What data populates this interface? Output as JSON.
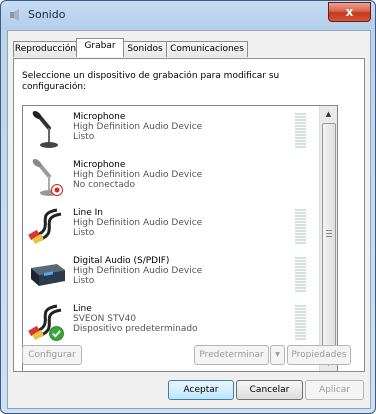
{
  "window": {
    "title": "Sonido",
    "close_label": "x"
  },
  "tabs": [
    {
      "label": "Reproducción"
    },
    {
      "label": "Grabar"
    },
    {
      "label": "Sonidos"
    },
    {
      "label": "Comunicaciones"
    }
  ],
  "active_tab": "Grabar",
  "instructions": "Seleccione un dispositivo de grabación para modificar su configuración:",
  "devices": [
    {
      "name": "Microphone",
      "description": "High Definition Audio Device",
      "status": "Listo",
      "icon": "microphone-icon",
      "badge": ""
    },
    {
      "name": "Microphone",
      "description": "High Definition Audio Device",
      "status": "No conectado",
      "icon": "microphone-icon",
      "badge": "disconnected-badge"
    },
    {
      "name": "Line In",
      "description": "High Definition Audio Device",
      "status": "Listo",
      "icon": "rca-cable-icon",
      "badge": ""
    },
    {
      "name": "Digital Audio (S/PDIF)",
      "description": "High Definition Audio Device",
      "status": "Listo",
      "icon": "digital-audio-device-icon",
      "badge": ""
    },
    {
      "name": "Line",
      "description": "SVEON STV40",
      "status": "Dispositivo predeterminado",
      "icon": "rca-cable-icon",
      "badge": "default-check-badge"
    }
  ],
  "buttons": {
    "configure": "Configurar",
    "set_default": "Predeterminar",
    "properties": "Propiedades",
    "accept": "Aceptar",
    "cancel": "Cancelar",
    "apply": "Aplicar"
  },
  "colors": {
    "accent": "#3c7fb1",
    "close": "#c2371f",
    "meter": "#cfe4d7"
  }
}
